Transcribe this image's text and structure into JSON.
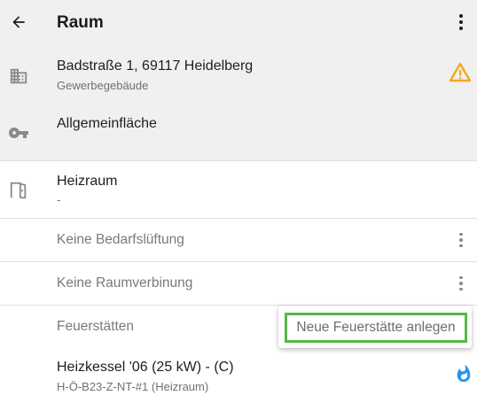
{
  "app_bar": {
    "title": "Raum",
    "back_icon": "arrow-back-icon",
    "menu_icon": "more-vert-icon"
  },
  "address": {
    "line1": "Badstraße 1, 69117 Heidelberg",
    "line2": "Gewerbegebäude",
    "icon": "building-icon",
    "warning_icon": "warning-triangle-icon"
  },
  "area": {
    "label": "Allgemeinfläche",
    "icon": "key-icon"
  },
  "room": {
    "name": "Heizraum",
    "sub": "-",
    "icon": "door-icon"
  },
  "rows": {
    "ventilation": "Keine Bedarfslüftung",
    "connection": "Keine Raumverbinung",
    "fireplaces": "Feuerstätten"
  },
  "popup": {
    "new_fireplace": "Neue Feuerstätte anlegen"
  },
  "boiler": {
    "title": "Heizkessel '06 (25 kW) - (C)",
    "sub": "H-Ö-B23-Z-NT-#1 (Heizraum)",
    "icon": "flame-icon"
  },
  "colors": {
    "header_bg": "#f0f0f0",
    "warning": "#f5a623",
    "flame": "#2196f3",
    "highlight": "#56b848"
  }
}
